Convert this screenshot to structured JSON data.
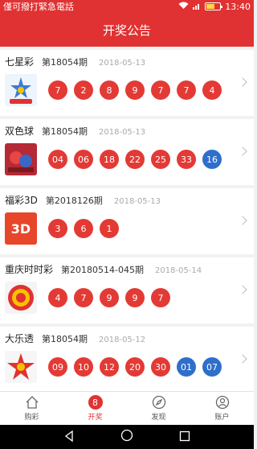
{
  "statusbar": {
    "carrier_text": "僅可撥打緊急電話",
    "time": "13:40",
    "battery_level": 0.6
  },
  "header": {
    "title": "开奖公告"
  },
  "lotteries": [
    {
      "name": "七星彩",
      "issue": "第18054期",
      "date": "2018-05-13",
      "logo_text": "七星彩",
      "logo_color": "#eef4fb",
      "numbers": [
        {
          "value": "7",
          "color": "red"
        },
        {
          "value": "2",
          "color": "red"
        },
        {
          "value": "8",
          "color": "red"
        },
        {
          "value": "9",
          "color": "red"
        },
        {
          "value": "7",
          "color": "red"
        },
        {
          "value": "7",
          "color": "red"
        },
        {
          "value": "4",
          "color": "red"
        }
      ]
    },
    {
      "name": "双色球",
      "issue": "第18054期",
      "date": "2018-05-13",
      "logo_text": "双色球",
      "logo_color": "#b42a35",
      "numbers": [
        {
          "value": "04",
          "color": "red"
        },
        {
          "value": "06",
          "color": "red"
        },
        {
          "value": "18",
          "color": "red"
        },
        {
          "value": "22",
          "color": "red"
        },
        {
          "value": "25",
          "color": "red"
        },
        {
          "value": "33",
          "color": "red"
        },
        {
          "value": "16",
          "color": "blue"
        }
      ]
    },
    {
      "name": "福彩3D",
      "issue": "第2018126期",
      "date": "2018-05-13",
      "logo_text": "3D",
      "logo_color": "#e7462a",
      "numbers": [
        {
          "value": "3",
          "color": "red"
        },
        {
          "value": "6",
          "color": "red"
        },
        {
          "value": "1",
          "color": "red"
        }
      ]
    },
    {
      "name": "重庆时时彩",
      "issue": "第20180514-045期",
      "date": "2018-05-14",
      "logo_text": "时时彩",
      "logo_color": "#f4f4f4",
      "numbers": [
        {
          "value": "4",
          "color": "red"
        },
        {
          "value": "7",
          "color": "red"
        },
        {
          "value": "9",
          "color": "red"
        },
        {
          "value": "9",
          "color": "red"
        },
        {
          "value": "7",
          "color": "red"
        }
      ]
    },
    {
      "name": "大乐透",
      "issue": "第18054期",
      "date": "2018-05-12",
      "logo_text": "大乐透",
      "logo_color": "#f6f6f6",
      "numbers": [
        {
          "value": "09",
          "color": "red"
        },
        {
          "value": "10",
          "color": "red"
        },
        {
          "value": "12",
          "color": "red"
        },
        {
          "value": "20",
          "color": "red"
        },
        {
          "value": "30",
          "color": "red"
        },
        {
          "value": "01",
          "color": "blue"
        },
        {
          "value": "07",
          "color": "blue"
        }
      ]
    }
  ],
  "tabs": [
    {
      "label": "购彩",
      "icon": "home-icon"
    },
    {
      "label": "开奖",
      "icon": "badge-icon",
      "badge": "8",
      "active": true
    },
    {
      "label": "发现",
      "icon": "compass-icon"
    },
    {
      "label": "账户",
      "icon": "user-icon"
    }
  ],
  "colors": {
    "primary": "#e03232",
    "red_ball": "#e33a35",
    "blue_ball": "#2e6fcb"
  }
}
